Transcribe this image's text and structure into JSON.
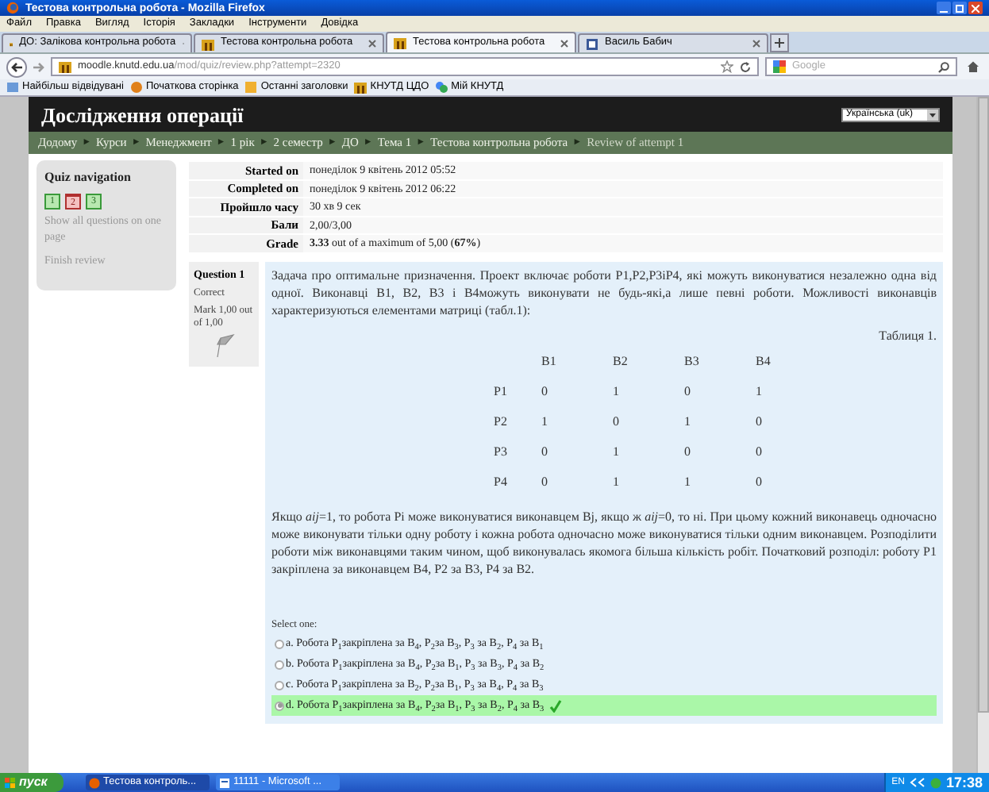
{
  "window": {
    "title": "Тестова контрольна робота - Mozilla Firefox"
  },
  "menu": [
    "Файл",
    "Правка",
    "Вигляд",
    "Історія",
    "Закладки",
    "Інструменти",
    "Довідка"
  ],
  "tabs": [
    {
      "label": "ДО: Залікова контрольна робота",
      "selected": false
    },
    {
      "label": "Тестова контрольна робота",
      "selected": false
    },
    {
      "label": "Тестова контрольна робота",
      "selected": true
    },
    {
      "label": "Василь Бабич",
      "selected": false
    }
  ],
  "address": {
    "host": "moodle.knutd.edu.ua",
    "path": "/mod/quiz/review.php?attempt=2320"
  },
  "search": {
    "placeholder": "Google"
  },
  "bookmarks": [
    "Найбільш відвідувані",
    "Початкова сторінка",
    "Останні заголовки",
    "КНУТД ЦДО",
    "Мій КНУТД"
  ],
  "site": {
    "title": "Дослідження операції",
    "language": "Українська (uk)"
  },
  "breadcrumb_separator": "►",
  "breadcrumb": [
    "Додому",
    "Курси",
    "Менеджмент",
    "1 рік",
    "2 семестр",
    "ДО",
    "Тема 1",
    "Тестова контрольна робота",
    "Review of attempt 1"
  ],
  "quiz_nav": {
    "title": "Quiz navigation",
    "questions": [
      {
        "label": "1",
        "kind": "correct"
      },
      {
        "label": "2",
        "kind": "incorrect"
      },
      {
        "label": "3",
        "kind": "correct"
      }
    ],
    "links": [
      "Show all questions on one page",
      "Finish review"
    ]
  },
  "summary": [
    {
      "label": "Started on",
      "value": "понеділок 9 квітень 2012 05:52"
    },
    {
      "label": "Completed on",
      "value": "понеділок 9 квітень 2012 06:22"
    },
    {
      "label": "Пройшло часу",
      "value": "30 хв 9 сек"
    },
    {
      "label": "Бали",
      "value": "2,00/3,00"
    },
    {
      "label": "Grade",
      "value": "**3.33** out of a maximum of 5,00 (**67%**)"
    }
  ],
  "question": {
    "number": "Question 1",
    "state": "Correct",
    "mark": "Mark 1,00 out of 1,00",
    "text": "Задача про оптимальне призначення. Проект включає роботи P1,P2,P3іP4, які можуть виконуватися незалежно одна від одної. Виконавці B1, B2, B3 і B4можуть виконувати не будь-які,а лише певні роботи. Можливості виконавців характеризуються елементами матриці (табл.1):",
    "table_caption": "Таблиця 1.",
    "table": {
      "columns": [
        "B1",
        "B2",
        "B3",
        "B4"
      ],
      "rows": [
        {
          "label": "P1",
          "cells": [
            "0",
            "1",
            "0",
            "1"
          ]
        },
        {
          "label": "P2",
          "cells": [
            "1",
            "0",
            "1",
            "0"
          ]
        },
        {
          "label": "P3",
          "cells": [
            "0",
            "1",
            "0",
            "0"
          ]
        },
        {
          "label": "P4",
          "cells": [
            "0",
            "1",
            "1",
            "0"
          ]
        }
      ]
    },
    "text2": "Якщо *aij*=1, то робота Pi може виконуватися виконавцем Bj, якщо ж *aij*=0, то ні. При цьому кожний виконавець одночасно може виконувати тільки одну роботу і кожна робота одночасно може виконуватися тільки одним виконавцем. Розподілити роботи між виконавцями таким чином, щоб виконувалась якомога більша кількість робіт. Початковий розподіл: роботу P1 закріплена за виконавцем B4, P2 за B3, P4 за B2.",
    "prompt": "Select one:",
    "options": [
      {
        "label": "a. Робота P$_{1}$закріплена за B$_{4}$, P$_{2}$за B$_{3}$, P$_{3}$ за B$_{2}$, P$_{4}$ за B$_{1}$",
        "selected": false,
        "correct": false
      },
      {
        "label": "b. Робота P$_{1}$закріплена за B$_{4}$, P$_{2}$за B$_{1}$, P$_{3}$ за B$_{3}$, P$_{4}$ за B$_{2}$",
        "selected": false,
        "correct": false
      },
      {
        "label": "c. Робота P$_{1}$закріплена за B$_{2}$, P$_{2}$за B$_{1}$, P$_{3}$ за B$_{4}$, P$_{4}$ за B$_{3}$",
        "selected": false,
        "correct": false
      },
      {
        "label": "d. Робота P$_{1}$закріплена за B$_{4}$, P$_{2}$за B$_{1}$, P$_{3}$ за B$_{2}$, P$_{4}$ за B$_{3}$",
        "selected": true,
        "correct": true
      }
    ]
  },
  "taskbar": {
    "start": "пуск",
    "tasks": [
      "Тестова контроль...",
      "11111 - Microsoft ..."
    ],
    "language": "EN",
    "time": "17:38"
  }
}
